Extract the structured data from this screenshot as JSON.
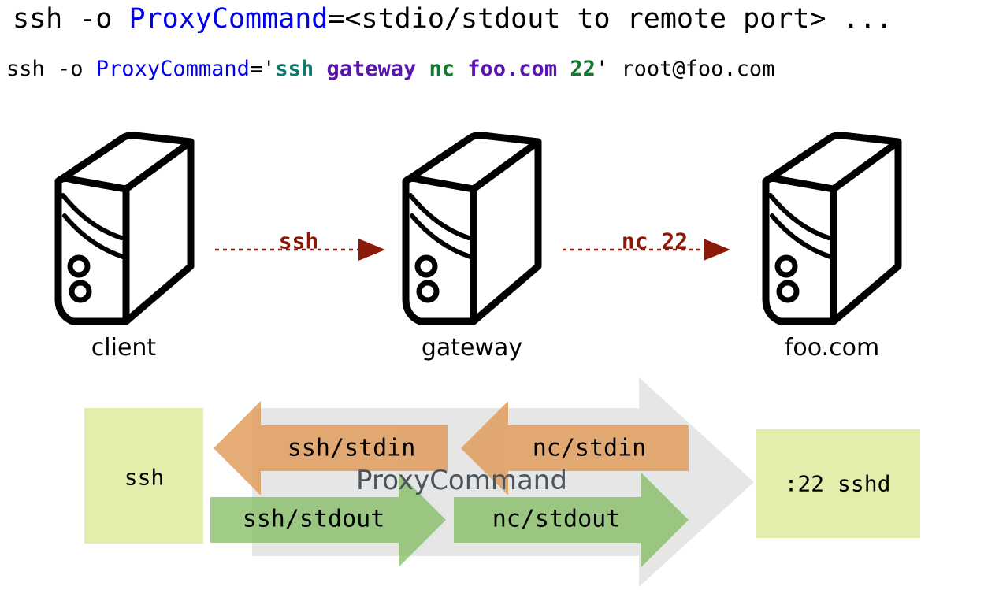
{
  "header": {
    "line1": {
      "pre": "ssh -o ",
      "keyword": "ProxyCommand",
      "post": "=<stdio/stdout to remote port> ..."
    },
    "line2": {
      "pre": "ssh -o ",
      "keyword": "ProxyCommand",
      "eq_quote": "='",
      "ssh": "ssh",
      "sp1": " ",
      "gateway": "gateway",
      "sp2": " ",
      "nc": "nc",
      "sp3": " ",
      "foo": "foo.com",
      "sp4": " ",
      "port": "22",
      "close_quote": "'",
      "user_host": " root@foo.com"
    }
  },
  "hosts": [
    {
      "id": "client",
      "label": "client"
    },
    {
      "id": "gateway",
      "label": "gateway"
    },
    {
      "id": "foocom",
      "label": "foo.com"
    }
  ],
  "links": [
    {
      "id": "client-to-gateway",
      "label": "ssh"
    },
    {
      "id": "gateway-to-foocom",
      "label": "nc 22"
    }
  ],
  "flow": {
    "proxycommand_label": "ProxyCommand",
    "left_box": "ssh",
    "right_box": ":22 sshd",
    "stdin_arrows": [
      {
        "id": "ssh-stdin",
        "label": "ssh/stdin"
      },
      {
        "id": "nc-stdin",
        "label": "nc/stdin"
      }
    ],
    "stdout_arrows": [
      {
        "id": "ssh-stdout",
        "label": "ssh/stdout"
      },
      {
        "id": "nc-stdout",
        "label": "nc/stdout"
      }
    ]
  },
  "colors": {
    "keyword_blue": "#0000ee",
    "ssh_teal": "#0b7a6e",
    "host_purple": "#5b16b0",
    "port_green": "#127a2c",
    "link_dark_red": "#8c1a08",
    "proxy_gray": "#e6e6e6",
    "proxy_text_gray": "#4b555d",
    "stdin_orange": "#e3a86f",
    "stdout_green": "#96c47d",
    "box_yellow": "#e4eeac",
    "server_outline": "#000000"
  }
}
